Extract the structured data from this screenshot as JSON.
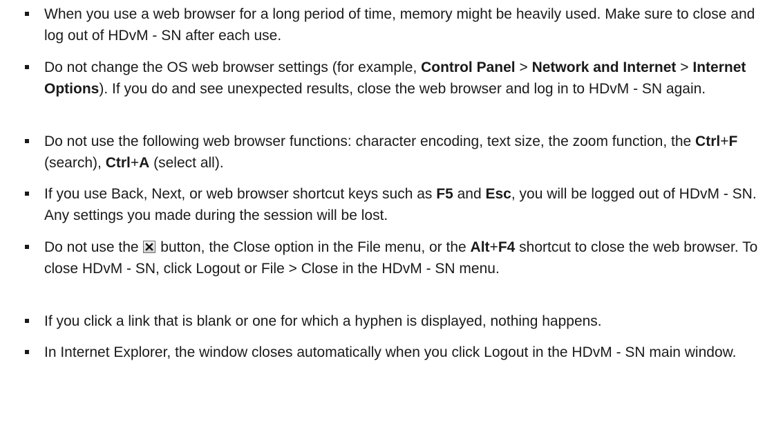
{
  "notes": [
    {
      "segments": [
        {
          "t": "When you use a web browser for a long period of time, memory might be heavily used. Make sure to close and log out of HDvM - SN after each use."
        }
      ]
    },
    {
      "segments": [
        {
          "t": "Do not change the OS web browser settings (for example, "
        },
        {
          "t": "Control Panel",
          "b": true
        },
        {
          "t": " > "
        },
        {
          "t": "Network and Internet",
          "b": true
        },
        {
          "t": " > "
        },
        {
          "t": "Internet Options",
          "b": true
        },
        {
          "t": "). If you do and see unexpected results, close the web browser and log in to HDvM - SN again."
        }
      ]
    },
    {
      "segments": [
        {
          "t": "Do not use the following web browser functions: character encoding, text size, the zoom function, the "
        },
        {
          "t": "Ctrl",
          "b": true
        },
        {
          "t": "+"
        },
        {
          "t": "F",
          "b": true
        },
        {
          "t": " (search), "
        },
        {
          "t": "Ctrl",
          "b": true
        },
        {
          "t": "+"
        },
        {
          "t": "A",
          "b": true
        },
        {
          "t": " (select all)."
        }
      ]
    },
    {
      "segments": [
        {
          "t": "If you use Back, Next, or web browser shortcut keys such as "
        },
        {
          "t": "F5",
          "b": true
        },
        {
          "t": " and "
        },
        {
          "t": "Esc",
          "b": true
        },
        {
          "t": ", you will be logged out of HDvM - SN. Any settings you made during the session will be lost."
        }
      ]
    },
    {
      "segments": [
        {
          "t": "Do not use the "
        },
        {
          "icon": "close-window-icon"
        },
        {
          "t": " button, the Close option in the File menu, or the "
        },
        {
          "t": "Alt",
          "b": true
        },
        {
          "t": "+"
        },
        {
          "t": "F4",
          "b": true
        },
        {
          "t": " shortcut to close the web browser. To close HDvM - SN, click Logout or File > Close in the HDvM - SN menu."
        }
      ]
    },
    {
      "segments": [
        {
          "t": "If you click a link that is blank or one for which a hyphen is displayed, nothing happens."
        }
      ]
    },
    {
      "segments": [
        {
          "t": "In Internet Explorer, the window closes automatically when you click Logout in the HDvM - SN main window."
        }
      ]
    }
  ]
}
